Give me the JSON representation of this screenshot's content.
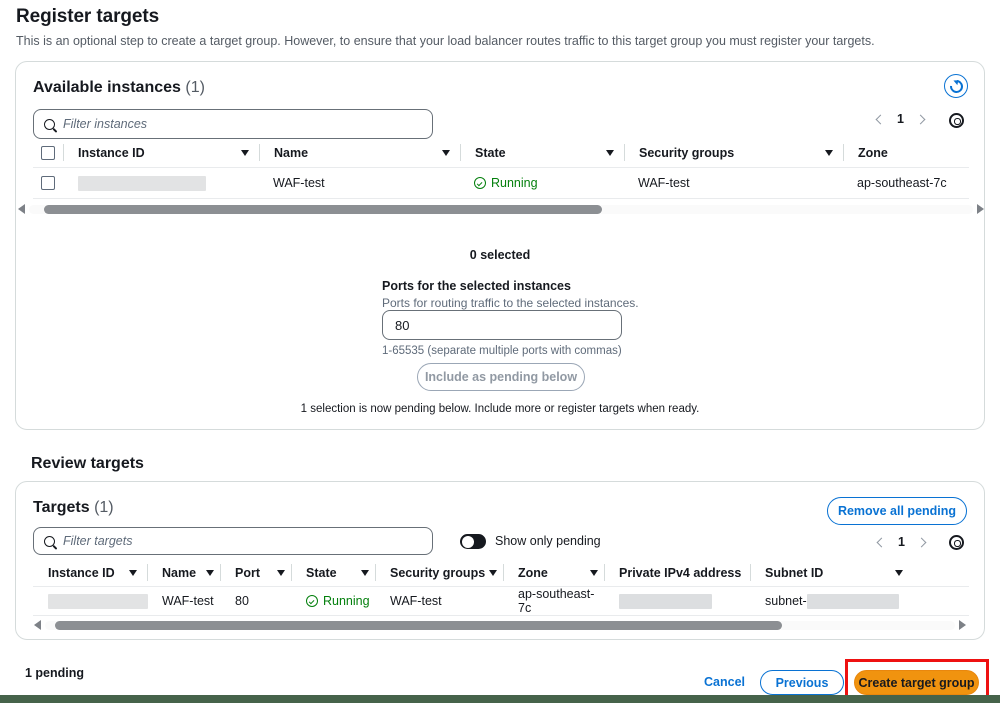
{
  "header": {
    "title": "Register targets",
    "subtitle": "This is an optional step to create a target group. However, to ensure that your load balancer routes traffic to this target group you must register your targets."
  },
  "available_instances": {
    "heading": "Available instances",
    "count": "(1)",
    "search": {
      "placeholder": "Filter instances"
    },
    "refresh_icon": "refresh-icon",
    "gear_icon": "gear-icon",
    "pagination": {
      "page": "1",
      "prev_icon": "chevron-left-icon",
      "next_icon": "chevron-right-icon"
    },
    "columns": [
      "Instance ID",
      "Name",
      "State",
      "Security groups",
      "Zone"
    ],
    "rows": [
      {
        "instance_id": "",
        "name": "WAF-test",
        "state": "Running",
        "security_groups": "WAF-test",
        "zone": "ap-southeast-7c"
      }
    ],
    "selected_label": "0 selected",
    "ports_label": "Ports for the selected instances",
    "ports_desc": "Ports for routing traffic to the selected instances.",
    "ports_value": "80",
    "ports_hint": "1-65535 (separate multiple ports with commas)",
    "include_button": "Include as pending below",
    "pending_note": "1 selection is now pending below. Include more or register targets when ready."
  },
  "review_targets": {
    "heading": "Review targets",
    "targets_heading": "Targets",
    "count": "(1)",
    "search": {
      "placeholder": "Filter targets"
    },
    "remove_all_button": "Remove all pending",
    "toggle_label": "Show only pending",
    "gear_icon": "gear-icon",
    "pagination": {
      "page": "1",
      "prev_icon": "chevron-left-icon",
      "next_icon": "chevron-right-icon"
    },
    "columns": [
      "Instance ID",
      "Name",
      "Port",
      "State",
      "Security groups",
      "Zone",
      "Private IPv4 address",
      "Subnet ID"
    ],
    "rows": [
      {
        "instance_id": "",
        "name": "WAF-test",
        "port": "80",
        "state": "Running",
        "security_groups": "WAF-test",
        "zone": "ap-southeast-7c",
        "private_ipv4": "",
        "subnet_id": "subnet-"
      }
    ]
  },
  "footer": {
    "pending_count": "1 pending",
    "cancel": "Cancel",
    "previous": "Previous",
    "create": "Create target group"
  },
  "colors": {
    "accent_blue": "#0972d3",
    "primary_orange": "#f0930f",
    "running_green": "#037f0c",
    "highlight_red": "#ee1111",
    "bottom_bar_green": "#46634a"
  }
}
